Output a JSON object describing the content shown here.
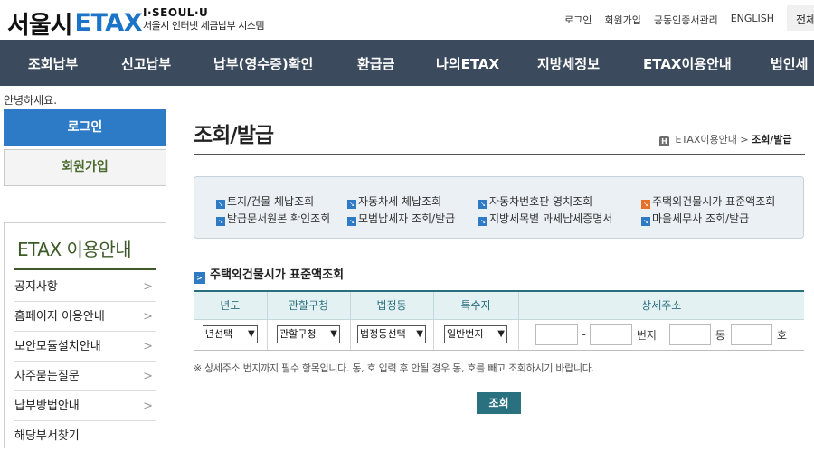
{
  "header": {
    "logo_ko": "서울시",
    "logo_en": "ETAX",
    "seoul_brand": "I·SEOUL·U",
    "seoul_sub": "서울시 인터넷 세금납부 시스템",
    "util": [
      "로그인",
      "회원가입",
      "공동인증서관리",
      "ENGLISH"
    ],
    "all_menu": "전체"
  },
  "nav": [
    "조회납부",
    "신고납부",
    "납부(영수증)확인",
    "환급금",
    "나의ETAX",
    "지방세정보",
    "ETAX이용안내",
    "법인세"
  ],
  "sidebar": {
    "greeting": "안녕하세요.",
    "login": "로그인",
    "join": "회원가입",
    "section_title": "ETAX 이용안내",
    "items": [
      "공지사항",
      "홈페이지 이용안내",
      "보안모듈설치안내",
      "자주묻는질문",
      "납부방법안내",
      "해당부서찾기"
    ]
  },
  "content": {
    "title": "조회/발급",
    "breadcrumb": [
      "ETAX이용안내",
      "조회/발급"
    ],
    "links": [
      {
        "label": "토지/건물 체납조회",
        "active": false
      },
      {
        "label": "자동차세 체납조회",
        "active": false
      },
      {
        "label": "자동차번호판 영치조회",
        "active": false
      },
      {
        "label": "주택외건물시가 표준액조회",
        "active": true
      },
      {
        "label": "발급문서원본 확인조회",
        "active": false
      },
      {
        "label": "모범납세자 조회/발급",
        "active": false
      },
      {
        "label": "지방세목별 과세납세증명서",
        "active": false
      },
      {
        "label": "마을세무사 조회/발급",
        "active": false
      }
    ],
    "section_title": "주택외건물시가 표준액조회",
    "table": {
      "headers": [
        "년도",
        "관할구청",
        "법정동",
        "특수지",
        "상세주소"
      ],
      "year_select": "년선택",
      "district_select": "관할구청",
      "dong_select": "법정동선택",
      "special_select": "일반번지",
      "addr_dash": "-",
      "addr_bunji": "번지",
      "addr_dong": "동",
      "addr_ho": "호"
    },
    "note": "※ 상세주소 번지까지 필수 항목입니다. 동, 호 입력 후 안될 경우 동, 호를 빼고 조회하시기 바랍니다.",
    "search_button": "조회"
  },
  "colors": {
    "nav_bg": "#3b4a5c",
    "accent_blue": "#2d7ac6",
    "teal": "#2a7180",
    "sidebar_green": "#3d5a28"
  }
}
